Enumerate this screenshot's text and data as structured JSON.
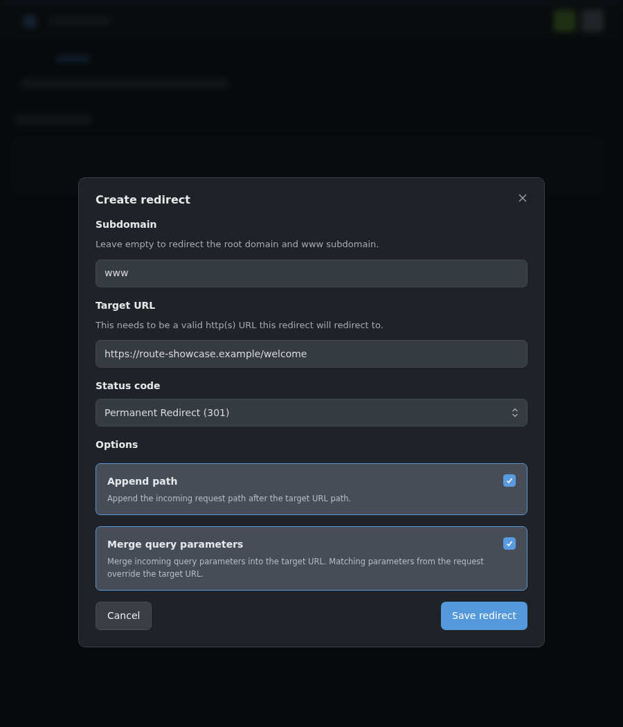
{
  "dialog": {
    "title": "Create redirect",
    "fields": [
      {
        "kind": "text",
        "label": "Subdomain",
        "help": "Leave empty to redirect the root domain and www subdomain.",
        "value": "www"
      },
      {
        "kind": "text",
        "label": "Target URL",
        "help": "This needs to be a valid http(s) URL this redirect will redirect to.",
        "value": "https://route-showcase.example/welcome"
      },
      {
        "kind": "select",
        "label": "Status code",
        "value": "Permanent Redirect (301)"
      }
    ],
    "options_label": "Options",
    "options": [
      {
        "title": "Append path",
        "description": "Append the incoming request path after the target URL path.",
        "checked": true
      },
      {
        "title": "Merge query parameters",
        "description": "Merge incoming query parameters into the target URL. Matching parameters from the request override the target URL.",
        "checked": true
      }
    ],
    "cancel": "Cancel",
    "submit": "Save redirect"
  }
}
